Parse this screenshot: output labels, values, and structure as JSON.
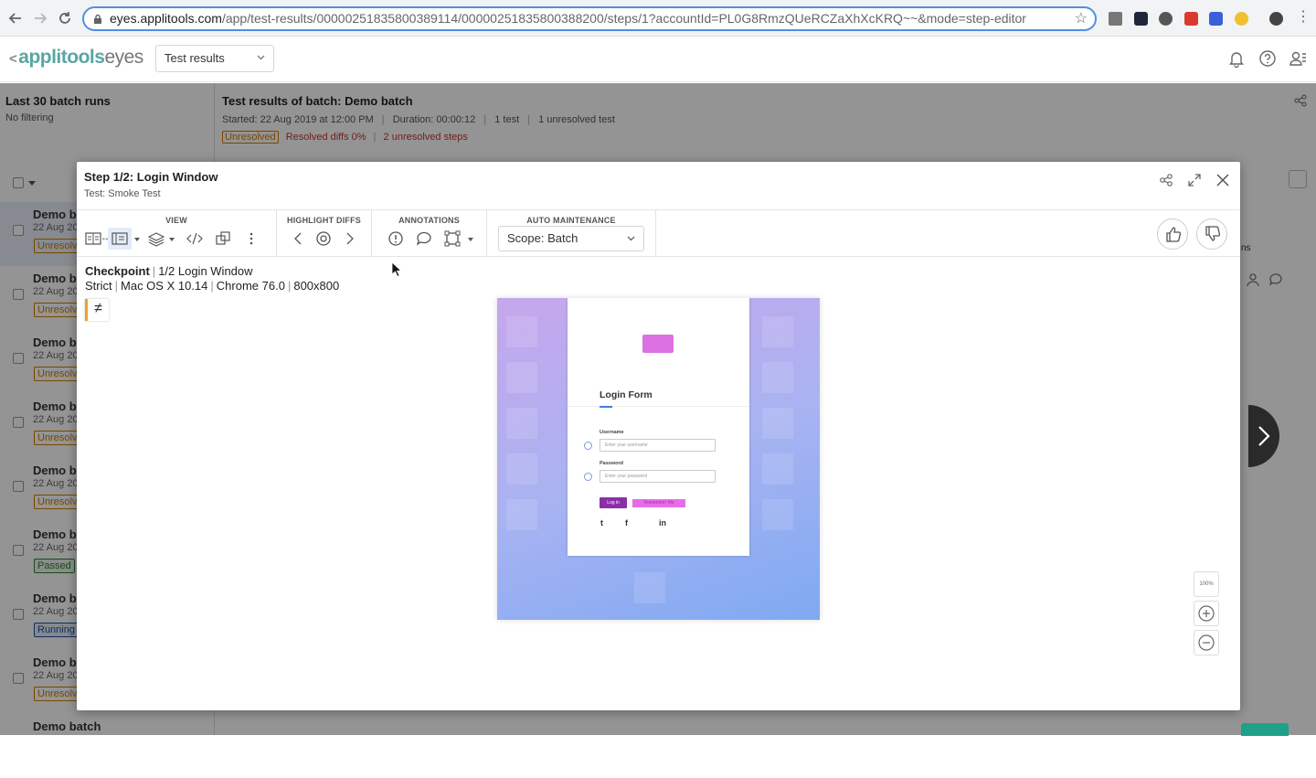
{
  "browser": {
    "url_host": "eyes.applitools.com",
    "url_path": "/app/test-results/00000251835800389114/00000251835800388200/steps/1?accountId=PL0G8RmzQUeRCZaXhXcKRQ~~&mode=step-editor"
  },
  "app": {
    "logo_main": "applitools",
    "logo_sub": "eyes",
    "view_select": "Test results"
  },
  "left_panel": {
    "title": "Last 30 batch runs",
    "filter": "No filtering",
    "batches": [
      {
        "name": "Demo ba",
        "date": "22 Aug 20",
        "status": "Unresolve"
      },
      {
        "name": "Demo ba",
        "date": "22 Aug 20",
        "status": "Unresolve"
      },
      {
        "name": "Demo ba",
        "date": "22 Aug 20",
        "status": "Unresolve"
      },
      {
        "name": "Demo ba",
        "date": "22 Aug 20",
        "status": "Unresolve"
      },
      {
        "name": "Demo ba",
        "date": "22 Aug 20",
        "status": "Unresolve"
      },
      {
        "name": "Demo ba",
        "date": "22 Aug 20",
        "status": "Passed"
      },
      {
        "name": "Demo ba",
        "date": "22 Aug 20",
        "status": "Running"
      },
      {
        "name": "Demo ba",
        "date": "22 Aug 20",
        "status": "Unresolve"
      },
      {
        "name": "Demo batch",
        "date": "",
        "status": ""
      }
    ]
  },
  "batch_info": {
    "title": "Test results of batch: Demo batch",
    "started": "Started: 22 Aug 2019 at 12:00 PM",
    "duration": "Duration: 00:00:12",
    "tests": "1 test",
    "unresolved_tests": "1 unresolved test",
    "status": "Unresolved",
    "resolved_diffs": "Resolved diffs 0%",
    "unresolved_steps": "2 unresolved steps"
  },
  "modal": {
    "title": "Step 1/2: Login Window",
    "subtitle": "Test: Smoke Test",
    "groups": {
      "view": "VIEW",
      "highlight": "HIGHLIGHT DIFFS",
      "annotations": "ANNOTATIONS",
      "auto_maintenance": "AUTO MAINTENANCE"
    },
    "scope": "Scope: Batch",
    "checkpoint_label": "Checkpoint",
    "checkpoint_name": "1/2 Login Window",
    "match_level": "Strict",
    "os": "Mac OS X 10.14",
    "browser": "Chrome 76.0",
    "viewport": "800x800",
    "diff_symbol": "≠"
  },
  "screenshot": {
    "form_title": "Login Form",
    "username_label": "Username",
    "username_placeholder": "Enter your username",
    "password_label": "Password",
    "password_placeholder": "Enter your password",
    "login_button": "Log in",
    "remember_me": "Remember Me",
    "social": [
      "t",
      "f",
      "in"
    ]
  },
  "zoom": {
    "fit_label": "100%"
  },
  "bg_right": {
    "column_fragment": "ns"
  },
  "colors": {
    "accent_blue": "#4d8fe6",
    "logo_teal": "#5aa5a3",
    "unresolved": "#d07a00",
    "diff_red": "#c0392b"
  }
}
